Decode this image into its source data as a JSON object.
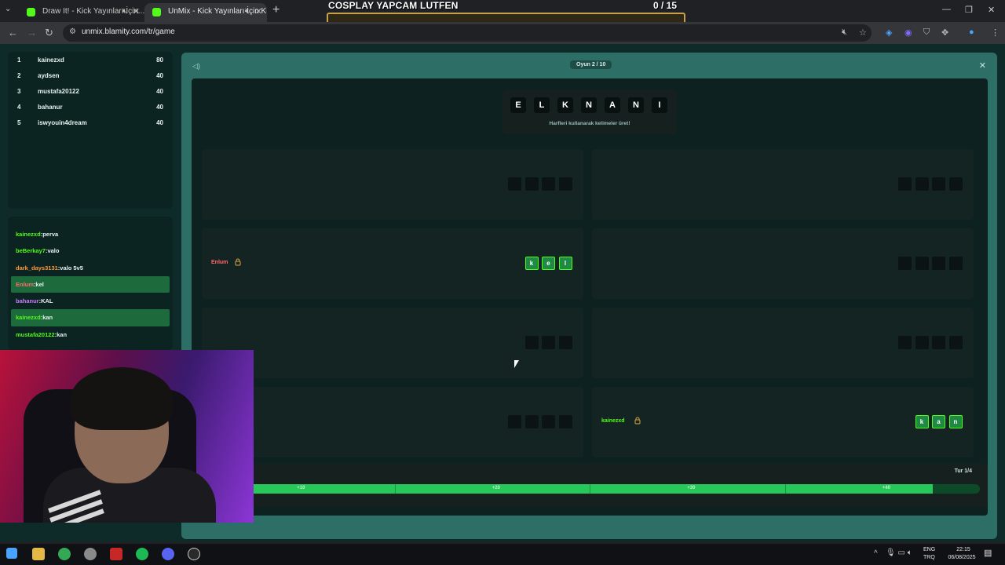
{
  "browser": {
    "tabs": [
      {
        "title": "Draw It! - Kick Yayınları İçin..."
      },
      {
        "title": "UnMix - Kick Yayınları İçin K..."
      }
    ],
    "url": "unmix.blamity.com/tr/game"
  },
  "overlay": {
    "goal_title": "COSPLAY YAPCAM LUTFEN",
    "goal_count": "0  / 15",
    "goal_progress": 0
  },
  "leaderboard": {
    "rows": [
      {
        "rank": "1",
        "name": "kainezxd",
        "score": "80"
      },
      {
        "rank": "2",
        "name": "aydsen",
        "score": "40"
      },
      {
        "rank": "3",
        "name": "mustafa20122",
        "score": "40"
      },
      {
        "rank": "4",
        "name": "bahanur",
        "score": "40"
      },
      {
        "rank": "5",
        "name": "iswyouin4dream",
        "score": "40"
      }
    ]
  },
  "chat": {
    "messages": [
      {
        "user": "kainezxd",
        "text": "perva",
        "color": "#53fc18"
      },
      {
        "user": "beBerkay7",
        "text": "valo",
        "color": "#53fc18"
      },
      {
        "user": "dark_days3131",
        "text": "valo 5v5",
        "color": "#ff9a3c"
      },
      {
        "user": "Enlum",
        "text": "kel",
        "color": "#ff6b6b"
      },
      {
        "user": "bahanur",
        "text": "KAL",
        "color": "#c77dff"
      },
      {
        "user": "kainezxd",
        "text": "kan",
        "color": "#53fc18"
      },
      {
        "user": "mustafa20122",
        "text": "kan",
        "color": "#53fc18"
      }
    ]
  },
  "game": {
    "round_label": "Oyun 2 / 10",
    "letters": [
      "E",
      "L",
      "K",
      "N",
      "A",
      "N",
      "I"
    ],
    "hint": "Harfleri kullanarak kelimeler üret!",
    "cards": [
      {
        "owner": "",
        "letters": [
          "",
          "",
          "",
          ""
        ]
      },
      {
        "owner": "",
        "letters": [
          "",
          "",
          "",
          ""
        ]
      },
      {
        "owner": "Enlum",
        "owner_color": "#ff6b6b",
        "letters": [
          "k",
          "e",
          "l"
        ]
      },
      {
        "owner": "",
        "letters": [
          "",
          "",
          "",
          ""
        ]
      },
      {
        "owner": "",
        "letters": [
          "",
          "",
          ""
        ]
      },
      {
        "owner": "",
        "letters": [
          "",
          "",
          "",
          ""
        ]
      },
      {
        "owner": "",
        "letters": [
          "",
          "",
          "",
          ""
        ]
      },
      {
        "owner": "kainezxd",
        "owner_color": "#53fc18",
        "letters": [
          "k",
          "a",
          "n"
        ]
      }
    ],
    "turn_label": "Tur 1/4",
    "progress": 0.94,
    "progress_marks": [
      "+10",
      "+20",
      "+30",
      "+40"
    ]
  },
  "taskbar": {
    "lang": "ENG",
    "region": "TRQ",
    "time": "22:15",
    "date": "06/08/2025"
  },
  "colors": {
    "accent": "#53fc18",
    "bg_page": "#0e2b2a",
    "bg_game": "#2d6e67"
  }
}
